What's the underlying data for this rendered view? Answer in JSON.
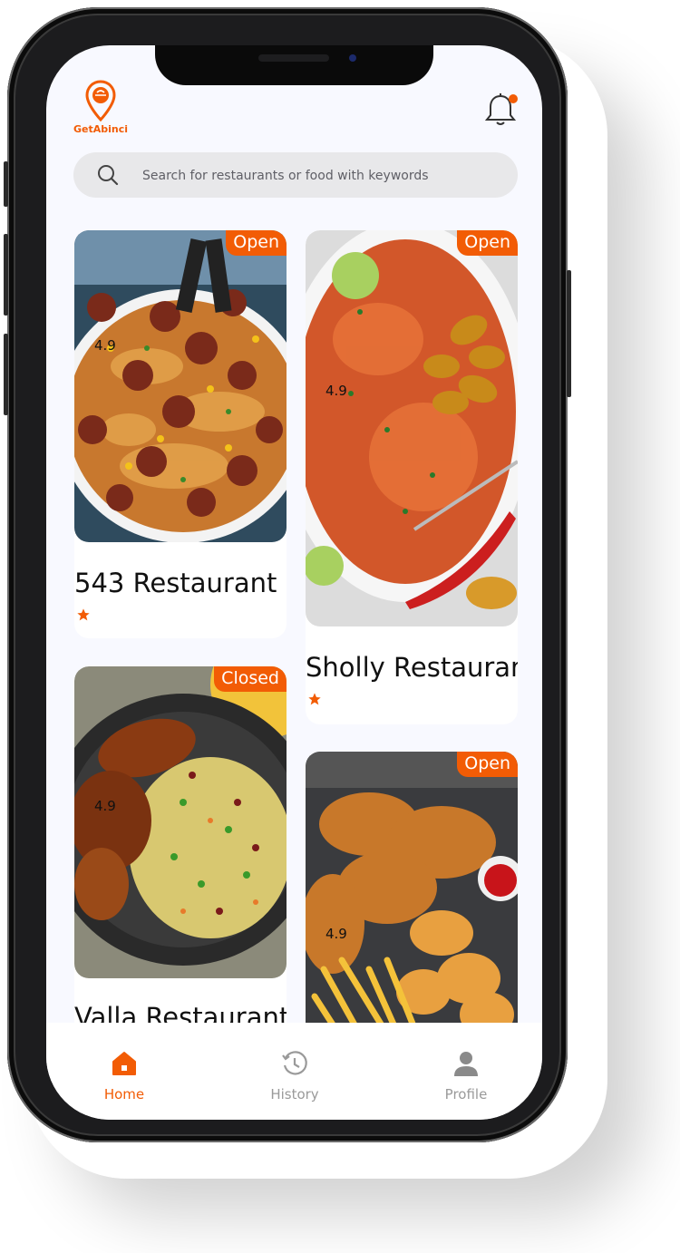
{
  "app": {
    "brand": "GetAbinci",
    "accent_color": "#f25c05"
  },
  "header": {
    "notification_icon": "bell-icon",
    "has_unread": true
  },
  "search": {
    "placeholder": "Search for restaurants or food with keywords",
    "value": ""
  },
  "restaurants": [
    {
      "name": "543 Restaurant",
      "status": "Open",
      "rating": "4.9",
      "image": "spaghetti-meatballs"
    },
    {
      "name": "Sholly Restaurant",
      "status": "Open",
      "rating": "4.9",
      "image": "jollof-rice-plantain"
    },
    {
      "name": "Valla Restaurant",
      "status": "Closed",
      "rating": "4.9",
      "image": "fried-rice-chicken"
    },
    {
      "name": "",
      "status": "Open",
      "rating": "4.9",
      "image": "fried-chicken-fries"
    }
  ],
  "nav": {
    "items": [
      {
        "label": "Home",
        "icon": "home-icon",
        "active": true
      },
      {
        "label": "History",
        "icon": "history-icon",
        "active": false
      },
      {
        "label": "Profile",
        "icon": "profile-icon",
        "active": false
      }
    ]
  }
}
